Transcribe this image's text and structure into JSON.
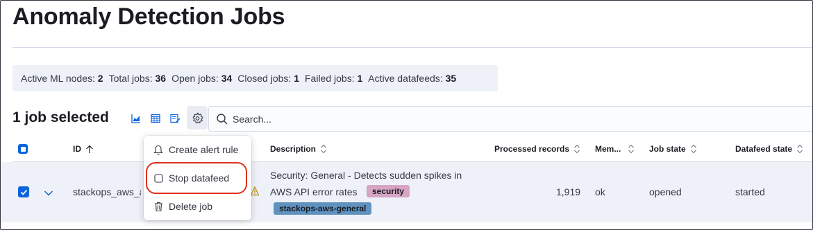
{
  "page": {
    "title": "Anomaly Detection Jobs"
  },
  "stats": [
    {
      "label": "Active ML nodes:",
      "value": "2"
    },
    {
      "label": "Total jobs:",
      "value": "36"
    },
    {
      "label": "Open jobs:",
      "value": "34"
    },
    {
      "label": "Closed jobs:",
      "value": "1"
    },
    {
      "label": "Failed jobs:",
      "value": "1"
    },
    {
      "label": "Active datafeeds:",
      "value": "35"
    }
  ],
  "toolbar": {
    "selected_label": "1 job selected",
    "icons": [
      "chart-icon",
      "table-icon",
      "edit-icon",
      "gear-icon"
    ],
    "search_placeholder": "Search..."
  },
  "table": {
    "headers": {
      "id": "ID",
      "description": "Description",
      "processed_records": "Processed records",
      "memory": "Mem...",
      "job_state": "Job state",
      "datafeed_state": "Datafeed state"
    },
    "row": {
      "id": "stackops_aws_a",
      "description_line1": "Security: General - Detects sudden spikes in",
      "description_line2": "AWS API error rates",
      "tag_security": "security",
      "tag_group": "stackops-aws-general",
      "processed_records": "1,919",
      "memory": "ok",
      "job_state": "opened",
      "datafeed_state": "started"
    }
  },
  "menu": {
    "create_alert": "Create alert rule",
    "stop_datafeed": "Stop datafeed",
    "delete_job": "Delete job"
  },
  "colors": {
    "accent": "#0b64dd",
    "highlight": "#e0301e",
    "security_badge": "#d6a5c4",
    "group_badge": "#6092c0"
  }
}
